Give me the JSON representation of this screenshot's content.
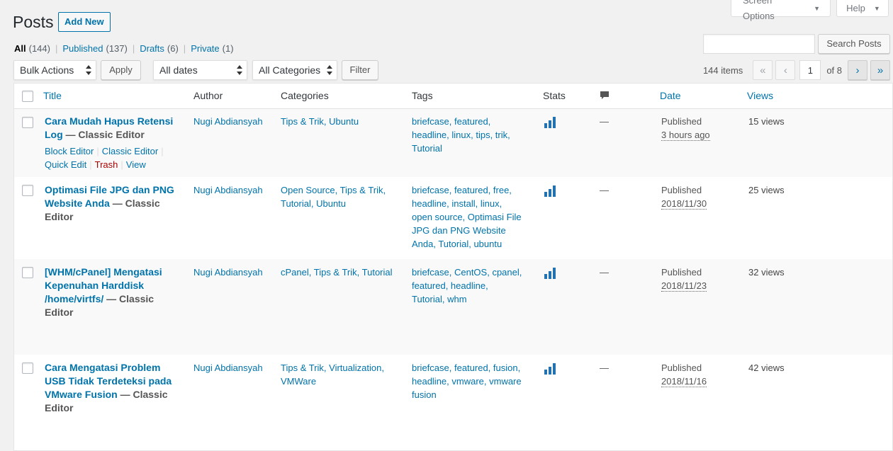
{
  "screen_options": {
    "label": "Screen Options"
  },
  "help": {
    "label": "Help"
  },
  "page": {
    "title": "Posts",
    "add_new": "Add New"
  },
  "views": [
    {
      "label": "All",
      "count": "(144)",
      "current": true
    },
    {
      "label": "Published",
      "count": "(137)"
    },
    {
      "label": "Drafts",
      "count": "(6)"
    },
    {
      "label": "Private",
      "count": "(1)"
    }
  ],
  "search": {
    "value": "",
    "button": "Search Posts"
  },
  "tablenav": {
    "bulk_actions": "Bulk Actions",
    "apply": "Apply",
    "dates": "All dates",
    "categories": "All Categories",
    "filter": "Filter",
    "items_count": "144 items",
    "first": "«",
    "prev": "‹",
    "current_page": "1",
    "of_pages": "of 8",
    "next": "›",
    "last": "»"
  },
  "columns": {
    "title": "Title",
    "author": "Author",
    "categories": "Categories",
    "tags": "Tags",
    "stats": "Stats",
    "date": "Date",
    "views": "Views"
  },
  "posts": [
    {
      "title_lines": [
        "Cara Mudah Hapus Retensi",
        "Log"
      ],
      "state": "— Classic Editor",
      "author": "Nugi Abdiansyah",
      "categories_lines": [
        "Tips & Trik, Ubuntu"
      ],
      "tags_lines": [
        "briefcase, featured,",
        "headline, linux, tips, trik,",
        "Tutorial"
      ],
      "comments": "—",
      "status": "Published",
      "date": "3 hours ago",
      "views": "15 views",
      "actions": {
        "block_editor": "Block Editor",
        "classic_editor": "Classic Editor",
        "quick_edit": "Quick Edit",
        "trash": "Trash",
        "view": "View"
      }
    },
    {
      "title_lines": [
        "Optimasi File JPG dan PNG",
        "Website Anda"
      ],
      "state": "— Classic",
      "state2": "Editor",
      "author": "Nugi Abdiansyah",
      "categories_lines": [
        "Open Source, Tips & Trik,",
        "Tutorial, Ubuntu"
      ],
      "tags_lines": [
        "briefcase, featured, free,",
        "headline, install, linux,",
        "open source, Optimasi File",
        "JPG dan PNG Website",
        "Anda, Tutorial, ubuntu"
      ],
      "comments": "—",
      "status": "Published",
      "date": "2018/11/30",
      "views": "25 views"
    },
    {
      "title_lines": [
        "[WHM/cPanel] Mengatasi",
        "Kepenuhan Harddisk",
        "/home/virtfs/"
      ],
      "state": "— Classic",
      "state2": "Editor",
      "author": "Nugi Abdiansyah",
      "categories_lines": [
        "cPanel, Tips & Trik, Tutorial"
      ],
      "tags_lines": [
        "briefcase, CentOS, cpanel,",
        "featured, headline,",
        "Tutorial, whm"
      ],
      "comments": "—",
      "status": "Published",
      "date": "2018/11/23",
      "views": "32 views"
    },
    {
      "title_lines": [
        "Cara Mengatasi Problem",
        "USB Tidak Terdeteksi pada",
        "VMware Fusion"
      ],
      "state": "— Classic",
      "state2": "Editor",
      "author": "Nugi Abdiansyah",
      "categories_lines": [
        "Tips & Trik, Virtualization,",
        "VMWare"
      ],
      "tags_lines": [
        "briefcase, featured, fusion,",
        "headline, vmware, vmware",
        "fusion"
      ],
      "comments": "—",
      "status": "Published",
      "date": "2018/11/16",
      "views": "42 views"
    }
  ]
}
